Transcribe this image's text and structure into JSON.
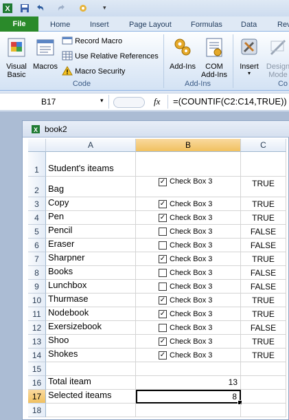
{
  "qat": {
    "icons": [
      "excel-logo-icon",
      "save-icon",
      "undo-icon",
      "redo-icon",
      "customize-icon"
    ]
  },
  "tabs": {
    "file": "File",
    "items": [
      "Home",
      "Insert",
      "Page Layout",
      "Formulas",
      "Data",
      "Rev"
    ]
  },
  "ribbon": {
    "code_group": {
      "visual_basic": "Visual\nBasic",
      "macros": "Macros",
      "record_macro": "Record Macro",
      "relative_refs": "Use Relative References",
      "macro_security": "Macro Security",
      "label": "Code"
    },
    "addins_group": {
      "addins": "Add-Ins",
      "com_addins": "COM\nAdd-Ins",
      "label": "Add-Ins"
    },
    "controls_group": {
      "insert": "Insert",
      "design_mode": "Design\nMode",
      "label": "Co"
    }
  },
  "formula_bar": {
    "name_box": "B17",
    "fx": "fx",
    "formula": "=(COUNTIF(C2:C14,TRUE))"
  },
  "workbook": {
    "title": "book2"
  },
  "columns": [
    "A",
    "B",
    "C"
  ],
  "selected_column": "B",
  "selected_row": "17",
  "rows": [
    {
      "num": "1",
      "a": "Student's iteams",
      "checked": null,
      "label": "",
      "c": ""
    },
    {
      "num": "2",
      "a": "Bag",
      "checked": true,
      "label": "Check Box 3",
      "c": "TRUE"
    },
    {
      "num": "3",
      "a": "Copy",
      "checked": true,
      "label": "Check Box 3",
      "c": "TRUE"
    },
    {
      "num": "4",
      "a": "Pen",
      "checked": true,
      "label": "Check Box 3",
      "c": "TRUE"
    },
    {
      "num": "5",
      "a": "Pencil",
      "checked": false,
      "label": "Check Box 3",
      "c": "FALSE"
    },
    {
      "num": "6",
      "a": "Eraser",
      "checked": false,
      "label": "Check Box 3",
      "c": "FALSE"
    },
    {
      "num": "7",
      "a": "Sharpner",
      "checked": true,
      "label": "Check Box 3",
      "c": "TRUE"
    },
    {
      "num": "8",
      "a": "Books",
      "checked": false,
      "label": "Check Box 3",
      "c": "FALSE"
    },
    {
      "num": "9",
      "a": "Lunchbox",
      "checked": false,
      "label": "Check Box 3",
      "c": "FALSE"
    },
    {
      "num": "10",
      "a": "Thurmase",
      "checked": true,
      "label": "Check Box 3",
      "c": "TRUE"
    },
    {
      "num": "11",
      "a": "Nodebook",
      "checked": true,
      "label": "Check Box 3",
      "c": "TRUE"
    },
    {
      "num": "12",
      "a": "Exersizebook",
      "checked": false,
      "label": "Check Box 3",
      "c": "FALSE"
    },
    {
      "num": "13",
      "a": "Shoo",
      "checked": true,
      "label": "Check Box 3",
      "c": "TRUE"
    },
    {
      "num": "14",
      "a": "Shokes",
      "checked": true,
      "label": "Check Box 3",
      "c": "TRUE"
    },
    {
      "num": "15",
      "a": "",
      "checked": null,
      "label": "",
      "c": ""
    },
    {
      "num": "16",
      "a": "Total iteam",
      "checked": null,
      "label": "",
      "b": "13",
      "c": ""
    },
    {
      "num": "17",
      "a": "Selected iteams",
      "checked": null,
      "label": "",
      "b": "8",
      "c": ""
    },
    {
      "num": "18",
      "a": "",
      "checked": null,
      "label": "",
      "c": ""
    }
  ],
  "colors": {
    "file_tab": "#2a8a2a",
    "selection_header": "#f1c15f",
    "ribbon_text": "#1e395b"
  }
}
